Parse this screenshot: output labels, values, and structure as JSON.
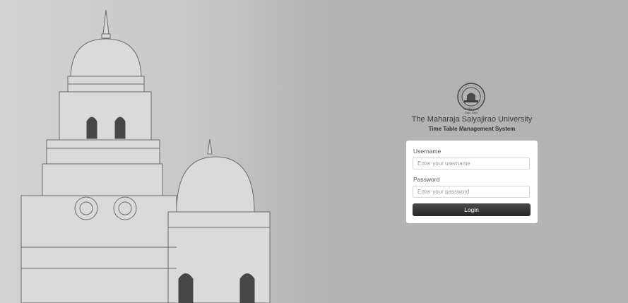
{
  "header": {
    "university_name": "The Maharaja Saiyajirao University",
    "system_name": "Time Table Management System"
  },
  "logo": {
    "icon": "university-seal-icon",
    "motto": "सत्यं शिवं सुन्दरम्",
    "established": "Estd. 1949"
  },
  "login_form": {
    "username_label": "Username",
    "username_placeholder": "Enter your username",
    "username_value": "",
    "password_label": "Password",
    "password_placeholder": "Enter your password",
    "password_value": "",
    "login_button": "Login"
  },
  "colors": {
    "page_background": "#b3b3b3",
    "card_background": "#ffffff",
    "button_background": "#333333",
    "button_text": "#ffffff"
  }
}
